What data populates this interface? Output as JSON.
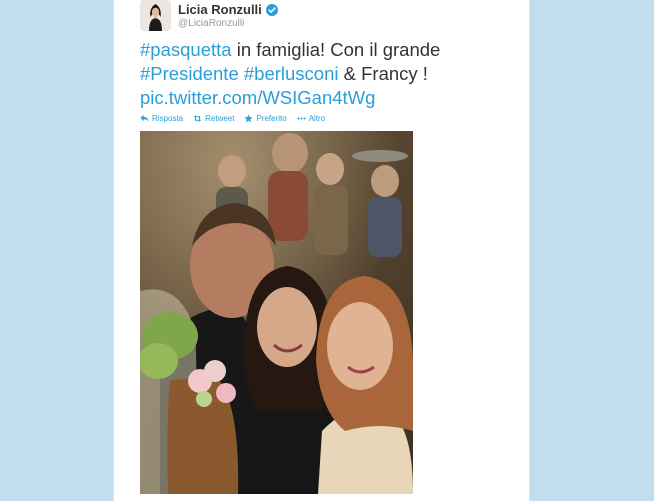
{
  "tweet": {
    "author_name": "Licia Ronzulli",
    "author_handle": "@LiciaRonzulli",
    "hashtag_pasquetta": "#pasquetta",
    "text_part1": " in famiglia! Con il grande",
    "hashtag_presidente": "#Presidente",
    "hashtag_berlusconi": "#berlusconi",
    "text_part2": " & Francy !",
    "link": "pic.twitter.com/WSIGan4tWg"
  },
  "actions": {
    "reply": "Risposta",
    "retweet": "Retweet",
    "favorite": "Preferito",
    "more": "Altro"
  },
  "icons": [
    "verified-badge-icon",
    "reply-icon",
    "retweet-icon",
    "favorite-star-icon",
    "more-dots-icon"
  ],
  "colors": {
    "page_background": "#c0deed",
    "link": "#2a9ed8",
    "text": "#333333",
    "handle": "#999999"
  }
}
